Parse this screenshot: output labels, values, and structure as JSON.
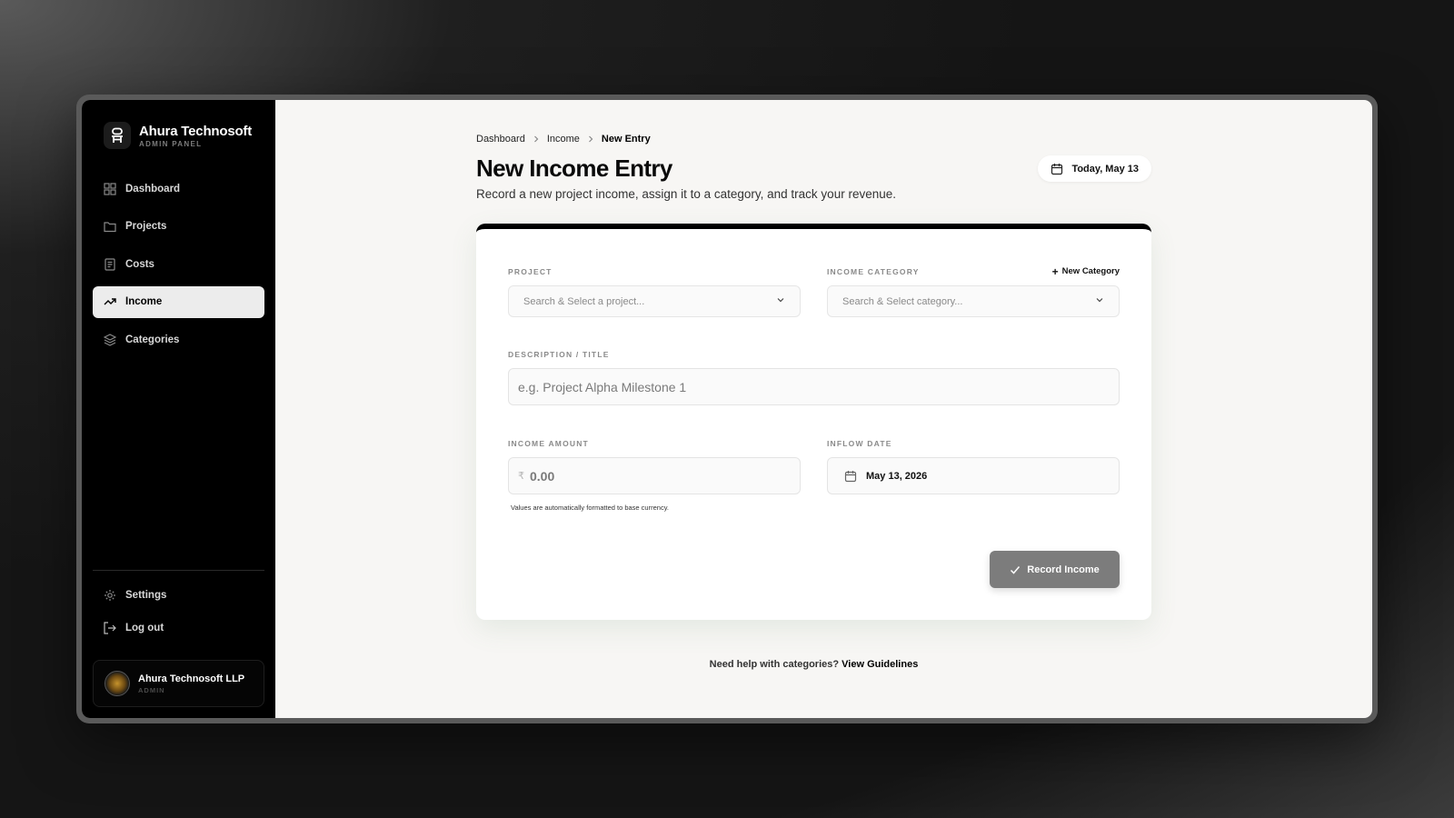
{
  "brand": {
    "title": "Ahura Technosoft",
    "subtitle": "ADMIN PANEL"
  },
  "sidebar": {
    "items": [
      {
        "label": "Dashboard",
        "icon": "grid-icon"
      },
      {
        "label": "Projects",
        "icon": "folder-icon"
      },
      {
        "label": "Costs",
        "icon": "receipt-icon"
      },
      {
        "label": "Income",
        "icon": "trending-up-icon",
        "active": true
      },
      {
        "label": "Categories",
        "icon": "layers-icon"
      }
    ],
    "footer": [
      {
        "label": "Settings",
        "icon": "gear-icon"
      },
      {
        "label": "Log out",
        "icon": "logout-icon"
      }
    ],
    "profile": {
      "name": "Ahura Technosoft LLP",
      "role": "ADMIN"
    }
  },
  "breadcrumb": [
    "Dashboard",
    "Income",
    "New Entry"
  ],
  "header": {
    "title": "New Income Entry",
    "description": "Record a new project income, assign it to a category, and track your revenue.",
    "date_chip": "Today, May 13"
  },
  "form": {
    "project": {
      "label": "PROJECT",
      "placeholder": "Search & Select a project..."
    },
    "category": {
      "label": "INCOME CATEGORY",
      "placeholder": "Search & Select category...",
      "new_label": "New Category"
    },
    "description": {
      "label": "DESCRIPTION / TITLE",
      "placeholder": "e.g. Project Alpha Milestone 1"
    },
    "amount": {
      "label": "INCOME AMOUNT",
      "currency": "₹",
      "placeholder": "0.00",
      "hint": "Values are automatically formatted to base currency."
    },
    "date": {
      "label": "INFLOW DATE",
      "value": "May 13, 2026"
    },
    "submit_label": "Record Income"
  },
  "help": {
    "text": "Need help with categories?",
    "link": "View Guidelines"
  },
  "colors": {
    "sidebar_bg": "#000000",
    "active_bg": "#ececec",
    "button_bg": "#7c7c7c",
    "page_bg": "#f7f6f4"
  }
}
